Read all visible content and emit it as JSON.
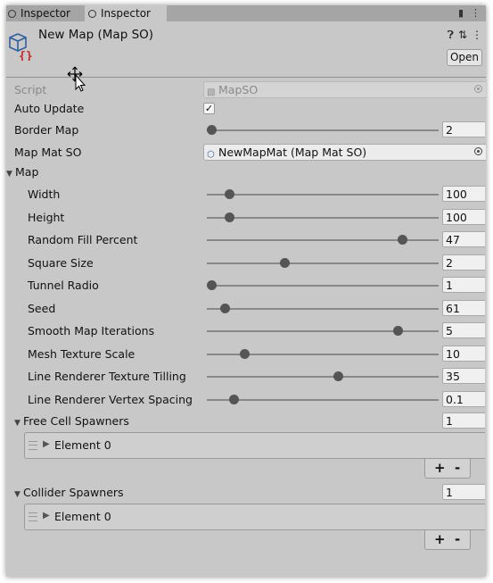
{
  "tabs": [
    {
      "label": "Inspector"
    },
    {
      "label": "Inspector"
    }
  ],
  "tab_icons": [
    "lock-icon",
    "menu-icon"
  ],
  "header": {
    "title": "New Map (Map SO)",
    "open_label": "Open",
    "icons": [
      "help-icon",
      "preset-icon",
      "kebab-menu-icon"
    ]
  },
  "fields": {
    "script": {
      "label": "Script",
      "value": "MapSO"
    },
    "auto_update": {
      "label": "Auto Update",
      "checked": true,
      "check_glyph": "✓"
    },
    "border_map": {
      "label": "Border Map",
      "value": "2",
      "fraction": 0.0
    },
    "map_mat_so": {
      "label": "Map Mat SO",
      "value": "NewMapMat (Map Mat SO)"
    },
    "map_section": {
      "label": "Map"
    }
  },
  "map_sliders": [
    {
      "label": "Width",
      "value": "100",
      "fraction": 0.08
    },
    {
      "label": "Height",
      "value": "100",
      "fraction": 0.08
    },
    {
      "label": "Random Fill Percent",
      "value": "47",
      "fraction": 0.86
    },
    {
      "label": "Square Size",
      "value": "2",
      "fraction": 0.33
    },
    {
      "label": "Tunnel Radio",
      "value": "1",
      "fraction": 0.0
    },
    {
      "label": "Seed",
      "value": "61",
      "fraction": 0.06
    },
    {
      "label": "Smooth Map Iterations",
      "value": "5",
      "fraction": 0.84
    },
    {
      "label": "Mesh Texture Scale",
      "value": "10",
      "fraction": 0.15
    },
    {
      "label": "Line Renderer Texture Tilling",
      "value": "35",
      "fraction": 0.57
    },
    {
      "label": "Line Renderer Vertex Spacing",
      "value": "0.1",
      "fraction": 0.1
    }
  ],
  "lists": {
    "free_cell_spawners": {
      "label": "Free Cell Spawners",
      "count": "1",
      "element": "Element 0",
      "add": "+",
      "remove": "-"
    },
    "collider_spawners": {
      "label": "Collider Spawners",
      "count": "1",
      "element": "Element 0",
      "add": "+",
      "remove": "-"
    }
  }
}
